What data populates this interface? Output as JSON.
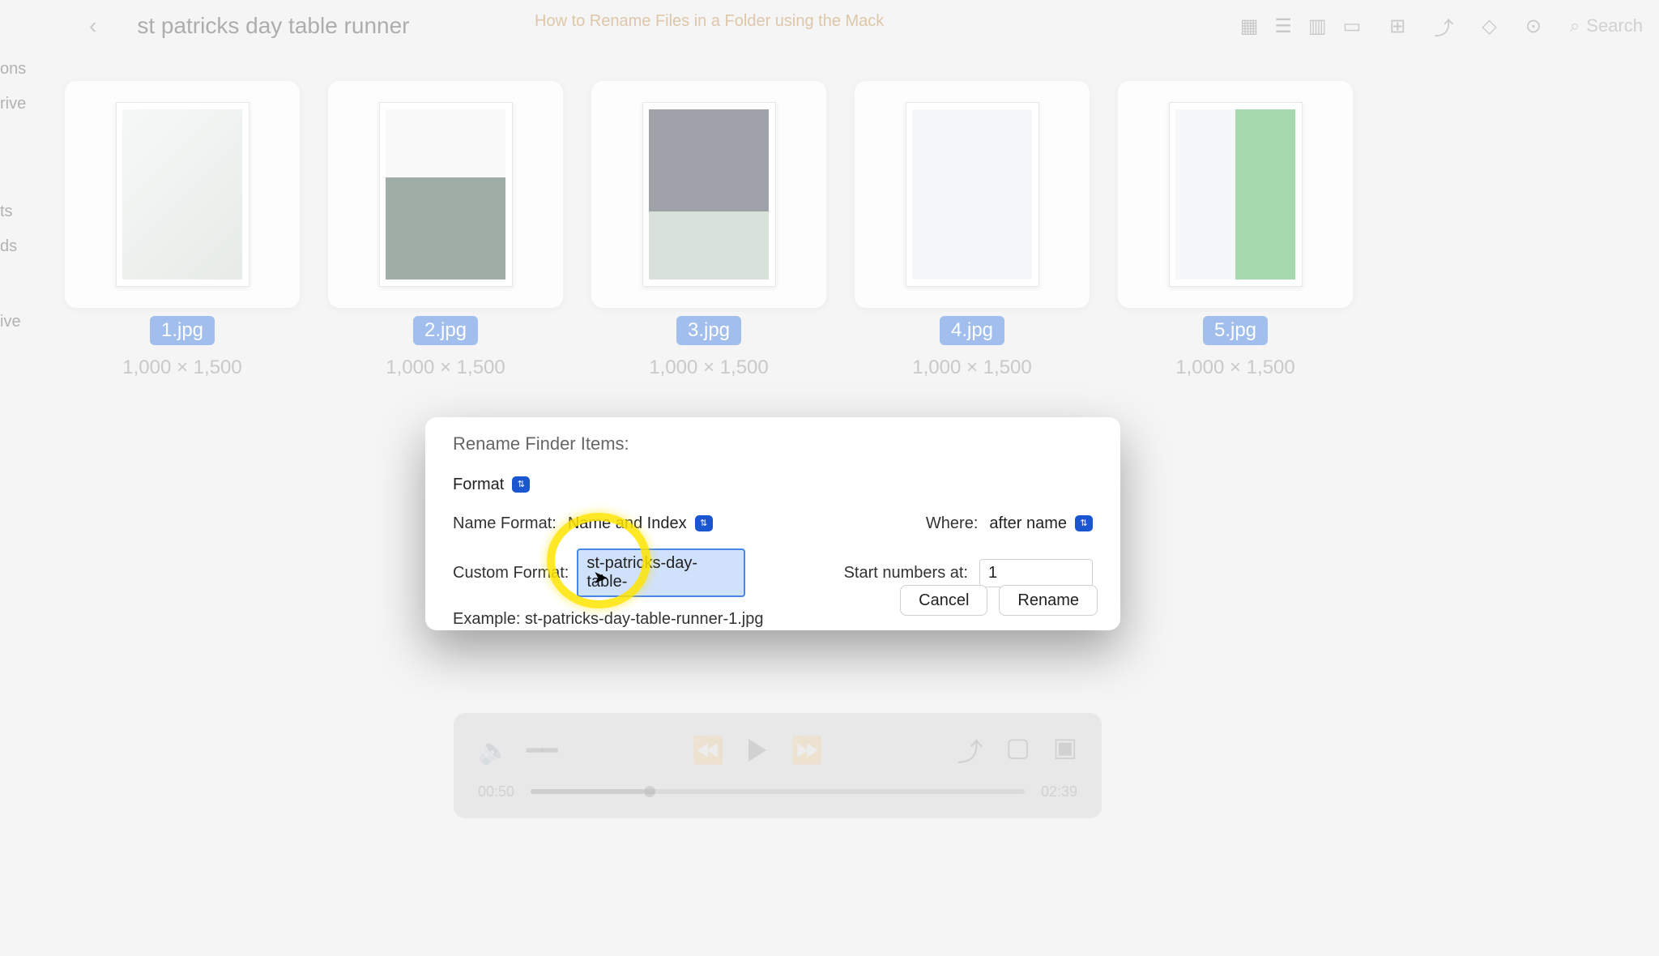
{
  "topbar": {
    "folder_title": "st patricks day table runner",
    "doc_tab": "How to Rename Files in a Folder using the Mack",
    "search_label": "Search"
  },
  "sidebar": {
    "items": [
      "ons",
      "rive",
      "ts",
      "ds",
      "ive"
    ]
  },
  "files": [
    {
      "name": "1.jpg",
      "dims": "1,000 × 1,500"
    },
    {
      "name": "2.jpg",
      "dims": "1,000 × 1,500"
    },
    {
      "name": "3.jpg",
      "dims": "1,000 × 1,500"
    },
    {
      "name": "4.jpg",
      "dims": "1,000 × 1,500"
    },
    {
      "name": "5.jpg",
      "dims": "1,000 × 1,500"
    }
  ],
  "dialog": {
    "title": "Rename Finder Items:",
    "mode_label": "Format",
    "name_format_label": "Name Format:",
    "name_format_value": "Name and Index",
    "where_label": "Where:",
    "where_value": "after name",
    "custom_format_label": "Custom Format:",
    "custom_format_value": "st-patricks-day-table-",
    "start_label": "Start numbers at:",
    "start_value": "1",
    "example_label": "Example: st-patricks-day-table-runner-1.jpg",
    "cancel": "Cancel",
    "rename": "Rename"
  },
  "video": {
    "time_current": "00:50",
    "time_total": "02:39"
  },
  "colors": {
    "selection_blue": "#2f6fd4",
    "focus_blue": "#4a86e8",
    "highlight_yellow": "#ffe400"
  }
}
